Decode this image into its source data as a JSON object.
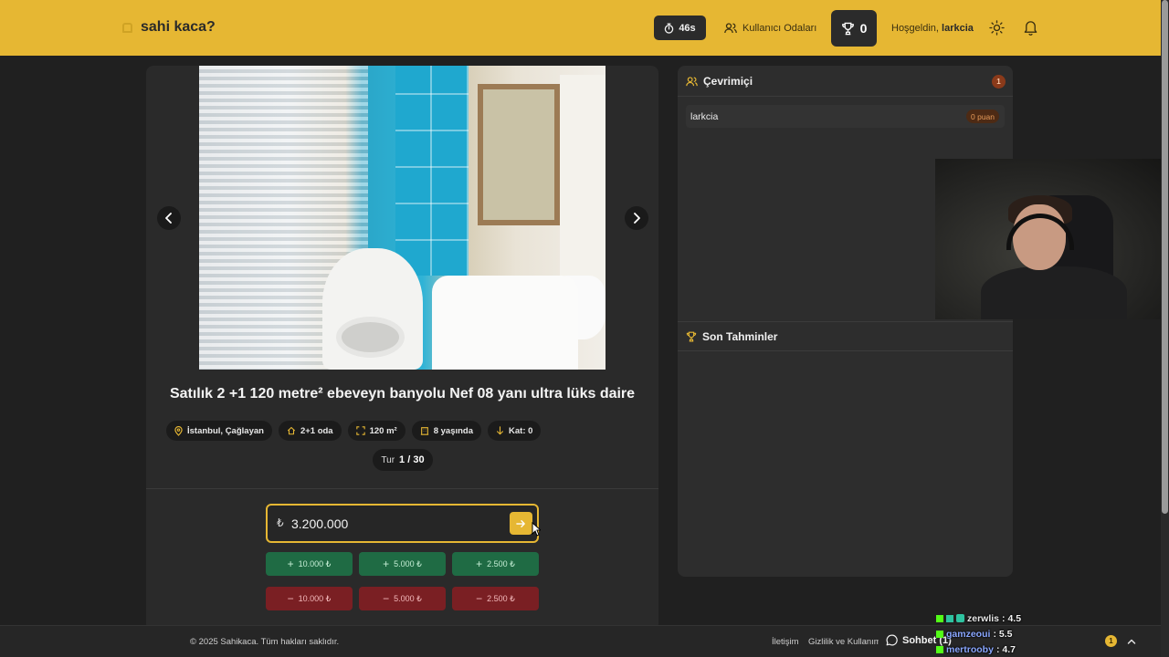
{
  "header": {
    "logo": "sahi kaca?",
    "timer": "46s",
    "rooms_label": "Kullanıcı Odaları",
    "score": "0",
    "welcome_prefix": "Hoşgeldin,",
    "username": "larkcia"
  },
  "listing": {
    "title": "Satılık 2 +1 120 metre² ebeveyn banyolu Nef 08 yanı ultra lüks daire",
    "tags": [
      {
        "icon": "location-pin-icon",
        "text": "İstanbul, Çağlayan"
      },
      {
        "icon": "house-icon",
        "text": "2+1 oda"
      },
      {
        "icon": "expand-icon",
        "text": "120 m²"
      },
      {
        "icon": "building-icon",
        "text": "8 yaşında"
      },
      {
        "icon": "arrow-down-icon",
        "text": "Kat: 0"
      }
    ],
    "round_label": "Tur",
    "round_value": "1 / 30"
  },
  "guess": {
    "currency": "₺",
    "value": "3.200.000",
    "plus": [
      "10.000 ₺",
      "5.000 ₺",
      "2.500 ₺"
    ],
    "minus": [
      "10.000 ₺",
      "5.000 ₺",
      "2.500 ₺"
    ]
  },
  "online": {
    "title": "Çevrimiçi",
    "count": "1",
    "users": [
      {
        "name": "larkcia",
        "points": "0 puan"
      }
    ]
  },
  "recent": {
    "title": "Son Tahminler"
  },
  "footer": {
    "copyright": "© 2025 Sahikaca. Tüm hakları saklıdır.",
    "contact": "İletişim",
    "privacy": "Gizlilik ve Kullanım",
    "chat": "Sohbet (1)",
    "notif_count": "1"
  },
  "stream_chat": [
    {
      "user": "zerwlis",
      "message": ": 4.5"
    },
    {
      "user": "gamzeoui",
      "message": ": 5.5"
    },
    {
      "user": "mertrooby",
      "message": ": 4.7"
    }
  ],
  "colors": {
    "accent": "#e6b733",
    "plus": "#1f6b44",
    "minus": "#7a1f23",
    "background": "#202020",
    "panel": "#2a2a2a"
  }
}
